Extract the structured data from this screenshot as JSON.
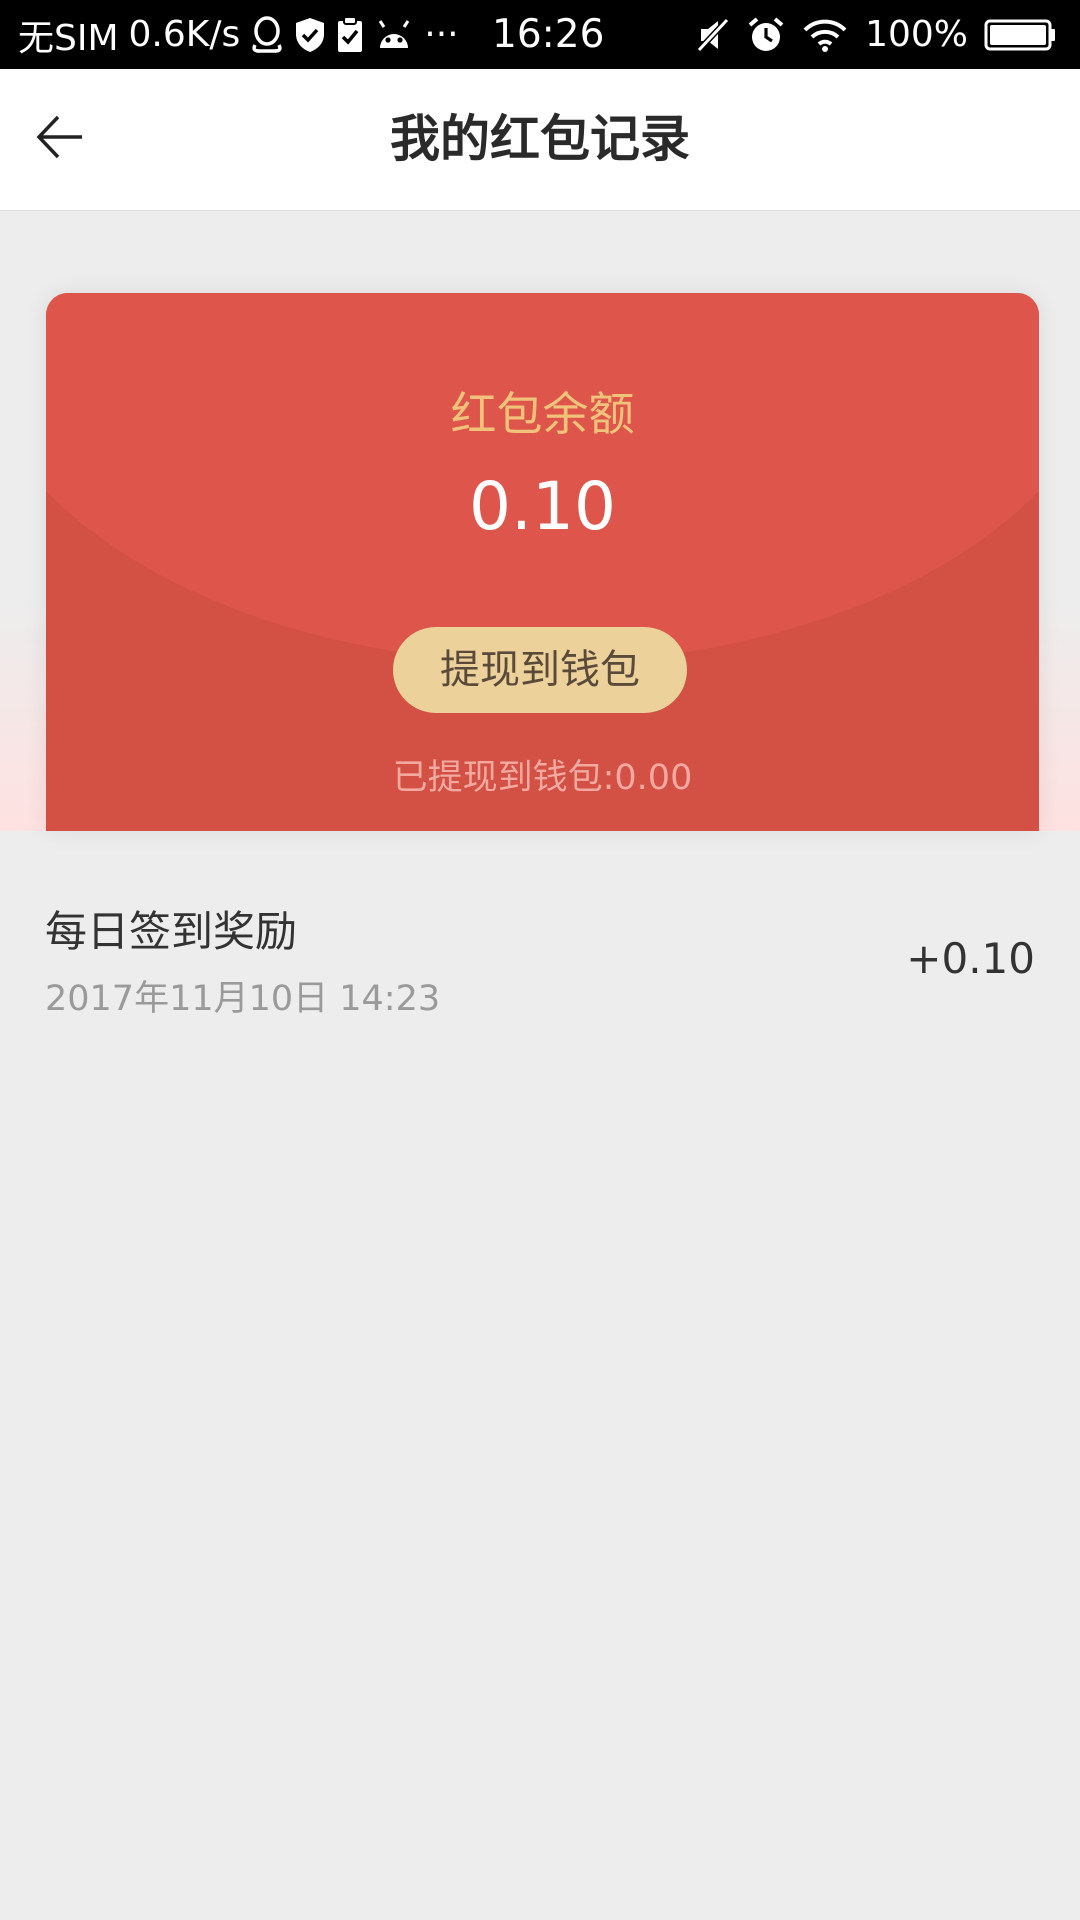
{
  "status_bar": {
    "carrier": "无SIM",
    "speed": "0.6K/s",
    "dots": "···",
    "time": "16:26",
    "battery": "100%",
    "icons": [
      "qq-icon",
      "shield-icon",
      "clipboard-check-icon",
      "android-icon",
      "mute-icon",
      "alarm-icon",
      "wifi-icon",
      "battery-icon"
    ]
  },
  "header": {
    "title": "我的红包记录",
    "back_icon": "arrow-left-icon"
  },
  "card": {
    "balance_label": "红包余额",
    "balance_value": "0.10",
    "withdraw_label": "提现到钱包",
    "withdrawn_text": "已提现到钱包:0.00",
    "colors": {
      "card": "#d35045",
      "flap": "#de564b",
      "label": "#f0c27a",
      "button": "#ecd19a"
    }
  },
  "records": [
    {
      "title": "每日签到奖励",
      "time": "2017年11月10日 14:23",
      "amount": "+0.10"
    }
  ]
}
